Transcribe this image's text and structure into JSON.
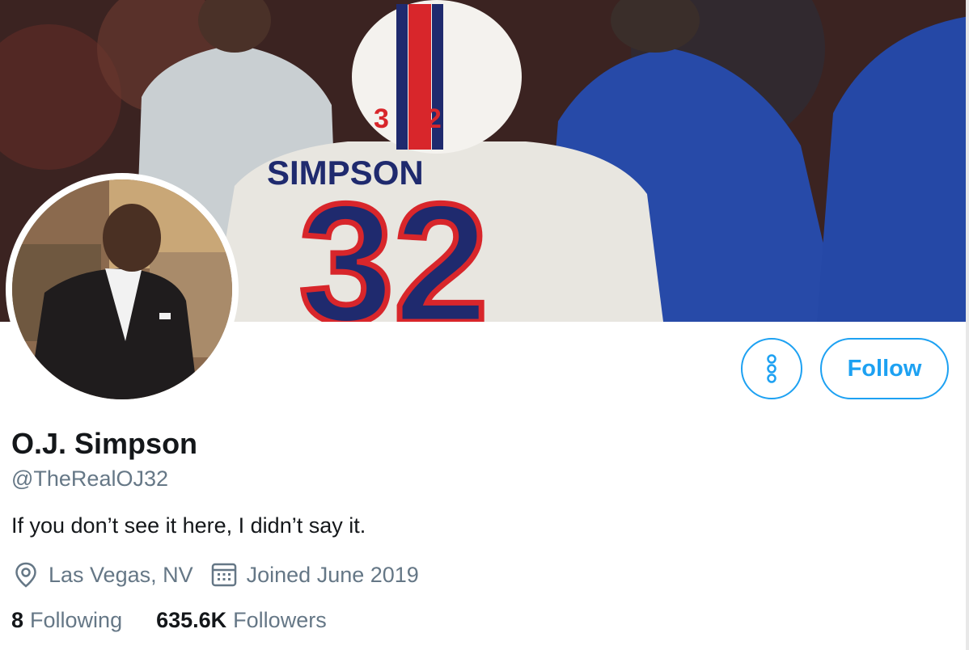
{
  "profile": {
    "name": "O.J. Simpson",
    "handle": "@TheRealOJ32",
    "bio": "If you don’t see it here, I didn’t say it.",
    "location": "Las Vegas, NV",
    "joined": "Joined June 2019",
    "following_count": "8",
    "following_label": "Following",
    "followers_count": "635.6K",
    "followers_label": "Followers"
  },
  "banner": {
    "jersey_name": "SIMPSON",
    "jersey_number": "32",
    "helmet_number": "32"
  },
  "actions": {
    "follow_label": "Follow",
    "more_icon": "more-vertical-icon"
  },
  "icons": {
    "location": "location-pin-icon",
    "joined": "calendar-icon"
  },
  "colors": {
    "accent": "#1da1f2",
    "text_primary": "#14171a",
    "text_secondary": "#657786"
  }
}
